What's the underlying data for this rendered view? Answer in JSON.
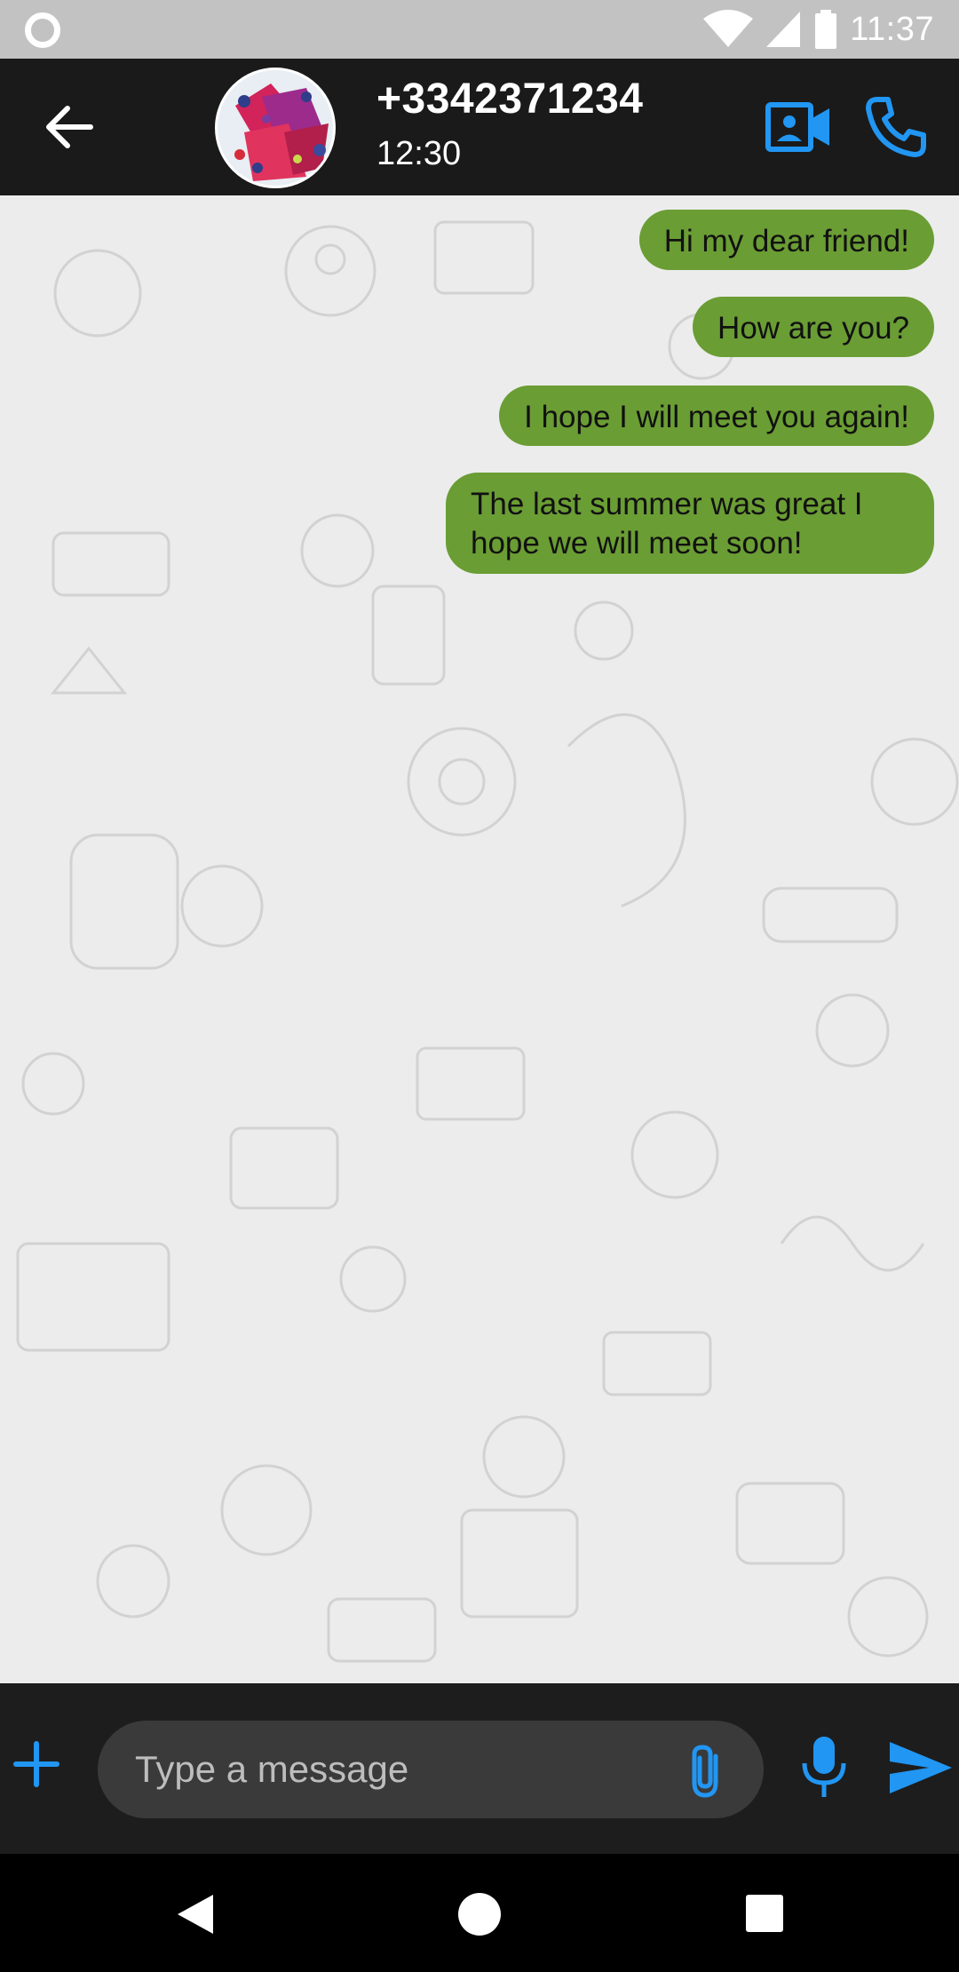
{
  "status_bar": {
    "time": "11:37",
    "icons": [
      "notification-dot-icon",
      "wifi-icon",
      "signal-icon",
      "battery-icon"
    ]
  },
  "header": {
    "contact_name": "+3342371234",
    "subtitle": "12:30",
    "icons": [
      "back-arrow-icon",
      "video-call-icon",
      "phone-icon"
    ]
  },
  "messages": [
    {
      "text": "Hi my dear friend!",
      "direction": "outgoing"
    },
    {
      "text": "How are you?",
      "direction": "outgoing"
    },
    {
      "text": "I hope I will meet you again!",
      "direction": "outgoing"
    },
    {
      "text": "The last summer was great I hope we will meet soon!",
      "direction": "outgoing"
    }
  ],
  "composer": {
    "placeholder": "Type a message",
    "value": "",
    "icons": [
      "plus-icon",
      "attachment-icon",
      "microphone-icon",
      "send-icon"
    ]
  },
  "nav_bar": {
    "icons": [
      "nav-back-icon",
      "nav-home-icon",
      "nav-recents-icon"
    ]
  },
  "colors": {
    "accent": "#2196f3",
    "outgoing_bubble": "#6a9d34",
    "header_bg": "#1a1a1a",
    "composer_bg": "#1d1d1d",
    "chat_bg": "#ececec"
  }
}
